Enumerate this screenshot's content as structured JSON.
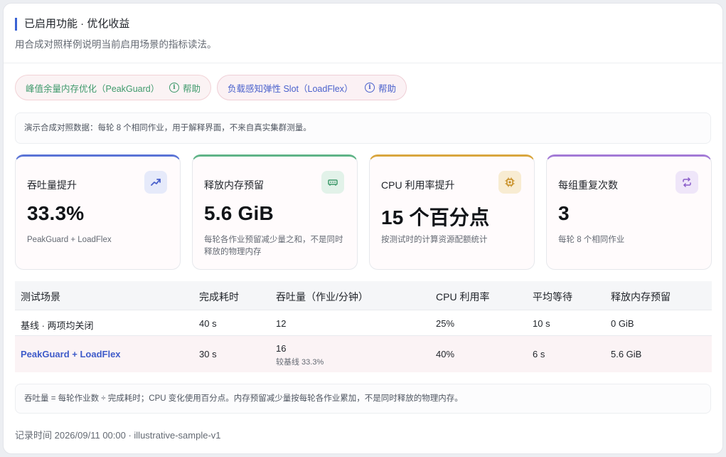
{
  "header": {
    "title": "已启用功能 · 优化收益",
    "subtitle": "用合成对照样例说明当前启用场景的指标读法。"
  },
  "chips": [
    {
      "label": "峰值余量内存优化（PeakGuard）",
      "help": "帮助",
      "color": "#3f9a6c"
    },
    {
      "label": "负载感知弹性 Slot（LoadFlex）",
      "help": "帮助",
      "color": "#4a61cc"
    }
  ],
  "notice": "演示合成对照数据：每轮 8 个相同作业，用于解释界面，不来自真实集群测量。",
  "cards": [
    {
      "title": "吞吐量提升",
      "value": "33.3%",
      "desc": "PeakGuard + LoadFlex",
      "icon": "trending-up-icon",
      "accent": "#5a74d6"
    },
    {
      "title": "释放内存预留",
      "value": "5.6 GiB",
      "desc": "每轮各作业预留减少量之和，不是同时释放的物理内存",
      "icon": "memory-icon",
      "accent": "#5fb487"
    },
    {
      "title": "CPU 利用率提升",
      "value": "15 个百分点",
      "desc": "按测试时的计算资源配额统计",
      "icon": "cpu-icon",
      "accent": "#d9a63e"
    },
    {
      "title": "每组重复次数",
      "value": "3",
      "desc": "每轮 8 个相同作业",
      "icon": "repeat-icon",
      "accent": "#a37ad6"
    }
  ],
  "table": {
    "headers": [
      "测试场景",
      "完成耗时",
      "吞吐量（作业/分钟）",
      "CPU 利用率",
      "平均等待",
      "释放内存预留"
    ],
    "rows": [
      {
        "scenario": "基线 · 两项均关闭",
        "duration": "40 s",
        "throughput": "12",
        "throughput_note": "",
        "cpu": "25%",
        "wait": "10 s",
        "memory": "0 GiB"
      },
      {
        "scenario": "PeakGuard + LoadFlex",
        "duration": "30 s",
        "throughput": "16",
        "throughput_note": "较基线 33.3%",
        "cpu": "40%",
        "wait": "6 s",
        "memory": "5.6 GiB"
      }
    ]
  },
  "footnote": "吞吐量 = 每轮作业数 ÷ 完成耗时；CPU 变化使用百分点。内存预留减少量按每轮各作业累加，不是同时释放的物理内存。",
  "record": "记录时间 2026/09/11 00:00 · illustrative-sample-v1"
}
